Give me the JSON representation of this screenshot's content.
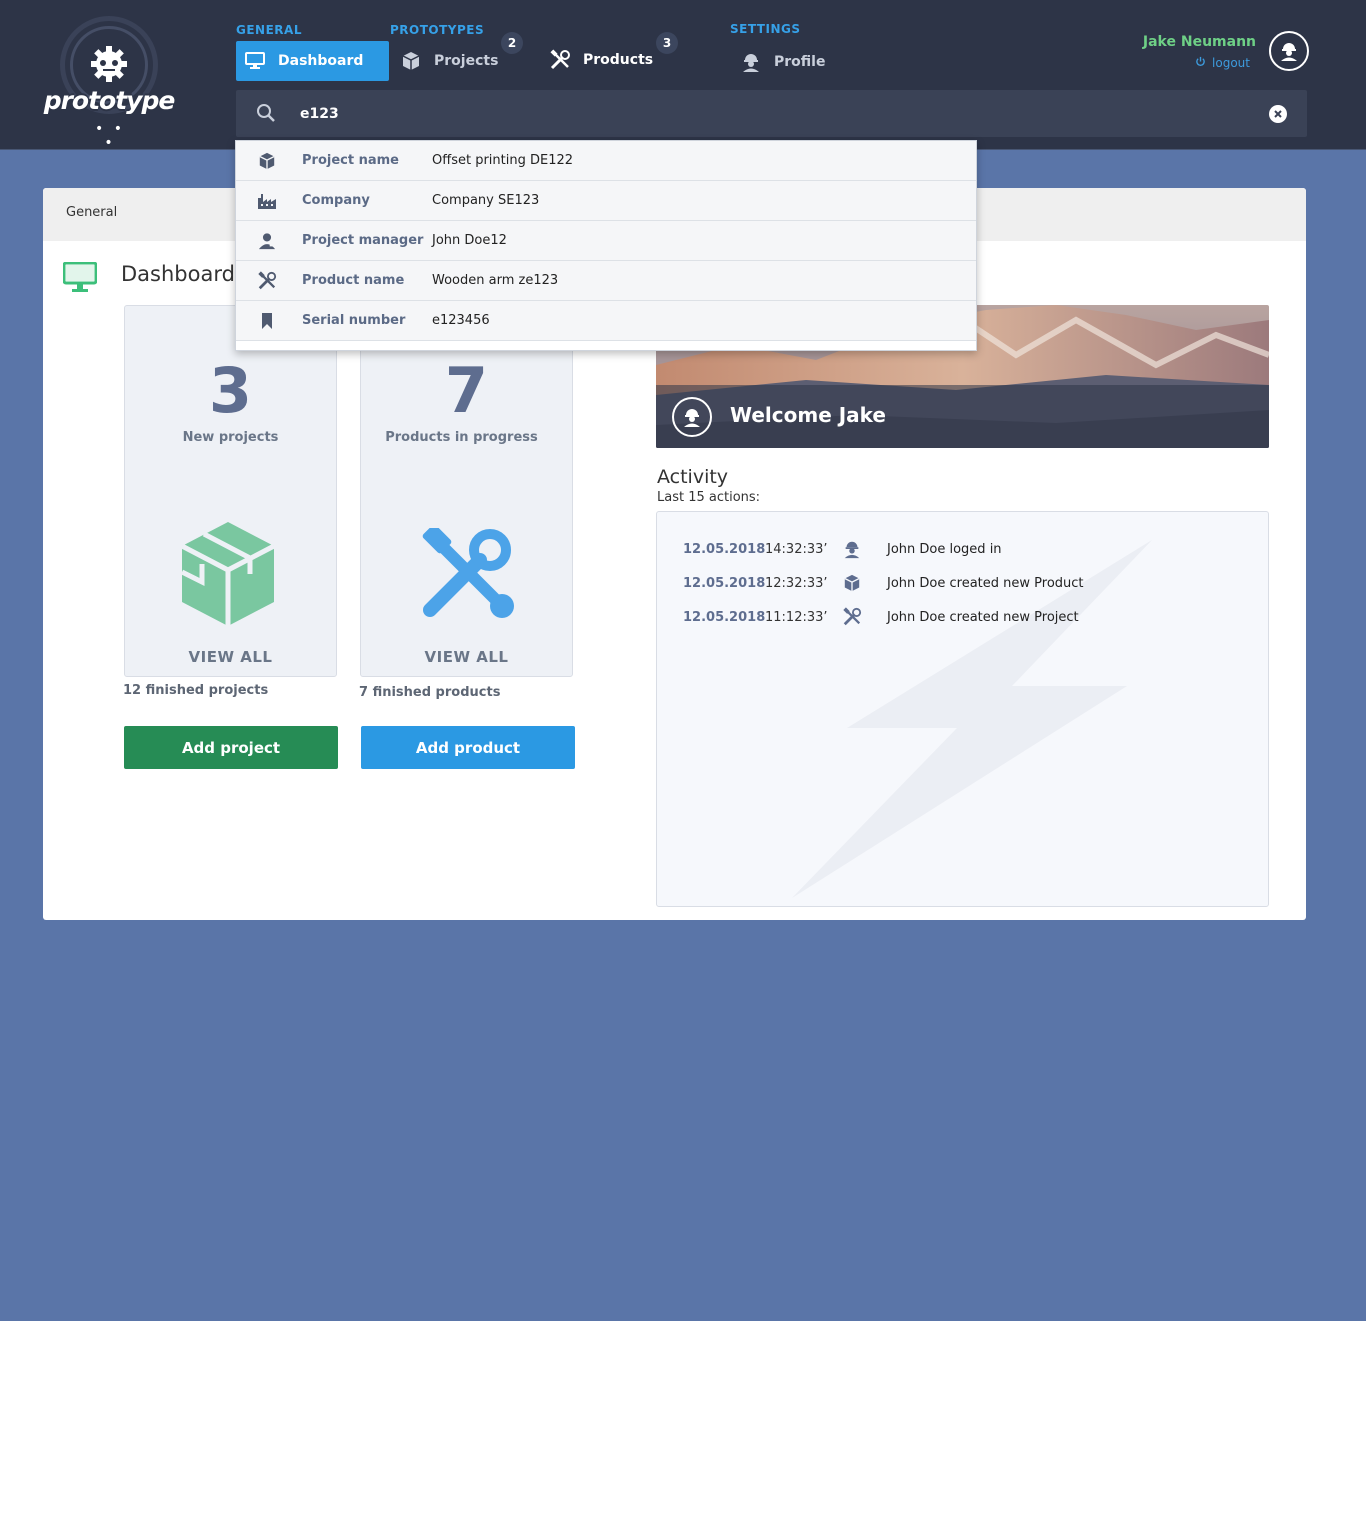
{
  "logo": {
    "text": "prototype",
    "dots": "• • •"
  },
  "nav": {
    "sections": [
      "GENERAL",
      "PROTOTYPES",
      "SETTINGS"
    ],
    "items": [
      {
        "label": "Dashboard",
        "icon": "monitor-icon",
        "active": true
      },
      {
        "label": "Projects",
        "icon": "box-icon",
        "badge": "2"
      },
      {
        "label": "Products",
        "icon": "tools-icon",
        "badge": "3"
      },
      {
        "label": "Profile",
        "icon": "worker-icon"
      }
    ]
  },
  "user": {
    "name": "Jake Neumann",
    "logout": "logout"
  },
  "search": {
    "value": "e123"
  },
  "dropdown": [
    {
      "icon": "box-icon",
      "key": "Project name",
      "value": "Offset printing DE122"
    },
    {
      "icon": "factory-icon",
      "key": "Company",
      "value": "Company SE123"
    },
    {
      "icon": "manager-icon",
      "key": "Project manager",
      "value": "John Doe12"
    },
    {
      "icon": "tools-icon",
      "key": "Product name",
      "value": "Wooden arm ze123"
    },
    {
      "icon": "bookmark-icon",
      "key": "Serial number",
      "value": "e123456"
    }
  ],
  "breadcrumb": "General",
  "page_title": "Dashboard",
  "stats": [
    {
      "number": "3",
      "label": "New projects",
      "view_all": "VIEW ALL",
      "finished": "12 finished projects",
      "button": "Add project",
      "color": "#268c55"
    },
    {
      "number": "7",
      "label": "Products in progress",
      "view_all": "VIEW ALL",
      "finished": "7 finished products",
      "button": "Add product",
      "color": "#2b99e3"
    }
  ],
  "welcome": "Welcome Jake",
  "activity": {
    "title": "Activity",
    "subtitle": "Last 15 actions:",
    "rows": [
      {
        "date": "12.05.2018",
        "time": "14:32:33’",
        "icon": "worker-icon",
        "text": "John Doe loged in"
      },
      {
        "date": "12.05.2018",
        "time": "12:32:33’",
        "icon": "box-icon",
        "text": "John Doe created new Product"
      },
      {
        "date": "12.05.2018",
        "time": "11:12:33’",
        "icon": "tools-icon",
        "text": "John Doe created new Project"
      }
    ]
  },
  "colors": {
    "accent": "#2b99e3",
    "topbar": "#2d3447",
    "background": "#5a75a8",
    "green": "#268c55",
    "user": "#6ed086"
  }
}
